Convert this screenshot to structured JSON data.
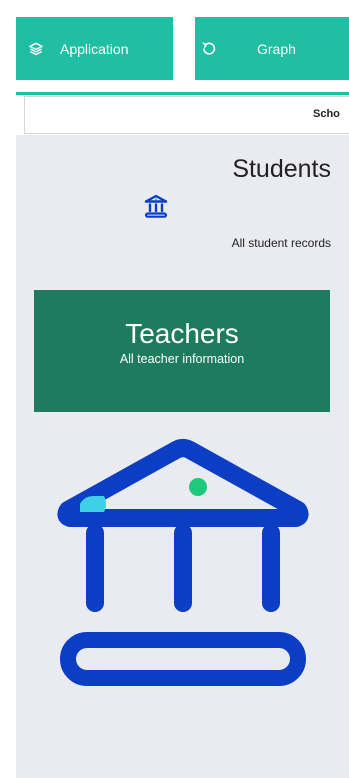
{
  "tabs": [
    {
      "label": "Application",
      "icon": "layers-icon"
    },
    {
      "label": "Graph",
      "icon": "refresh-icon"
    }
  ],
  "school_bar": {
    "text": "Scho"
  },
  "students": {
    "title": "Students",
    "subtitle": "All student records",
    "icon": "institution-icon"
  },
  "teachers": {
    "title": "Teachers",
    "subtitle": "All teacher information"
  },
  "hero_icon": {
    "name": "institution-icon"
  },
  "colors": {
    "tab_bg": "#20bea3",
    "teachers_bg": "#1e7b5d",
    "panel_bg": "#eaebf0",
    "icon_blue": "#0b3ec4",
    "icon_cyan": "#3dd0e6",
    "icon_green": "#1ec97d"
  }
}
